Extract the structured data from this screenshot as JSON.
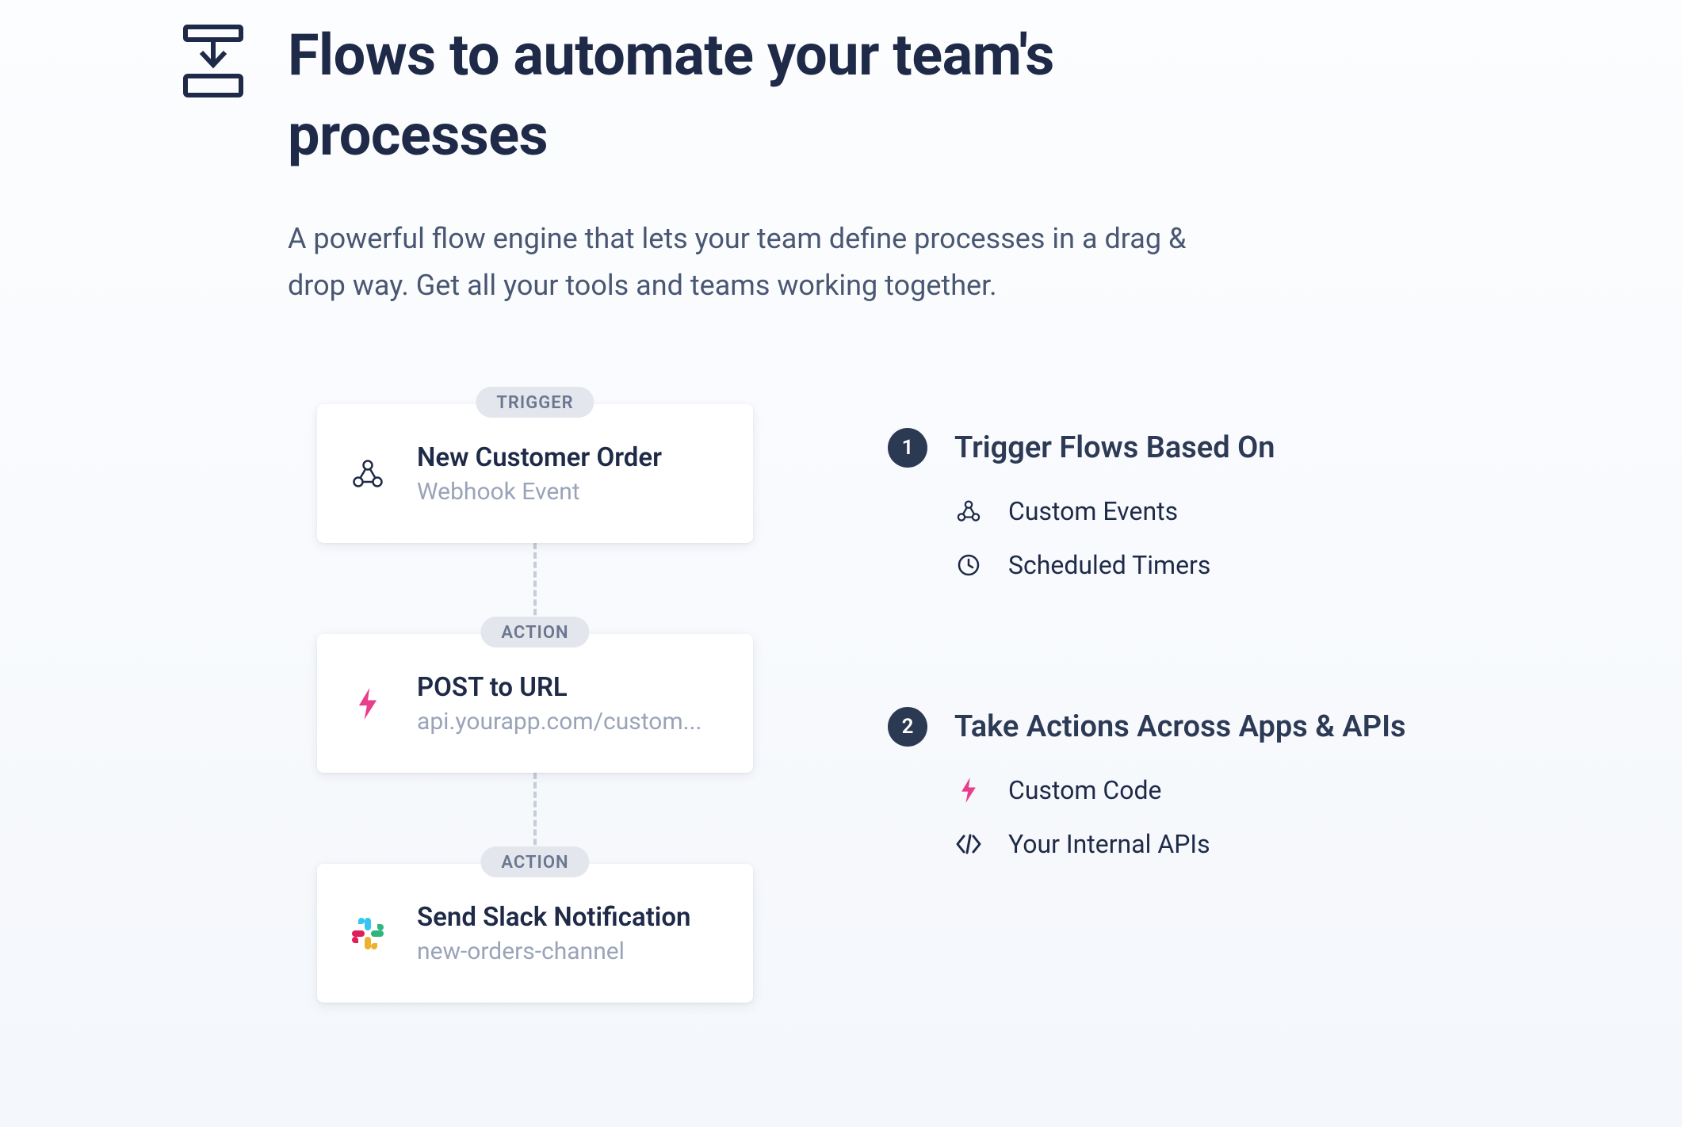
{
  "hero": {
    "title": "Flows to automate your team's processes",
    "subtitle": "A powerful flow engine that lets your team define processes in a drag & drop way. Get all your tools and teams working together."
  },
  "flow": {
    "nodes": [
      {
        "pill": "TRIGGER",
        "title": "New Customer Order",
        "subtitle": "Webhook Event",
        "icon": "webhook"
      },
      {
        "pill": "ACTION",
        "title": "POST to URL",
        "subtitle": "api.yourapp.com/custom...",
        "icon": "bolt"
      },
      {
        "pill": "ACTION",
        "title": "Send Slack Notification",
        "subtitle": "new-orders-channel",
        "icon": "slack"
      }
    ]
  },
  "features": [
    {
      "num": "1",
      "title": "Trigger Flows Based On",
      "items": [
        {
          "icon": "webhook",
          "label": "Custom Events"
        },
        {
          "icon": "clock",
          "label": "Scheduled Timers"
        }
      ]
    },
    {
      "num": "2",
      "title": "Take Actions Across Apps & APIs",
      "items": [
        {
          "icon": "bolt",
          "label": "Custom Code"
        },
        {
          "icon": "code",
          "label": "Your Internal APIs"
        }
      ]
    }
  ]
}
